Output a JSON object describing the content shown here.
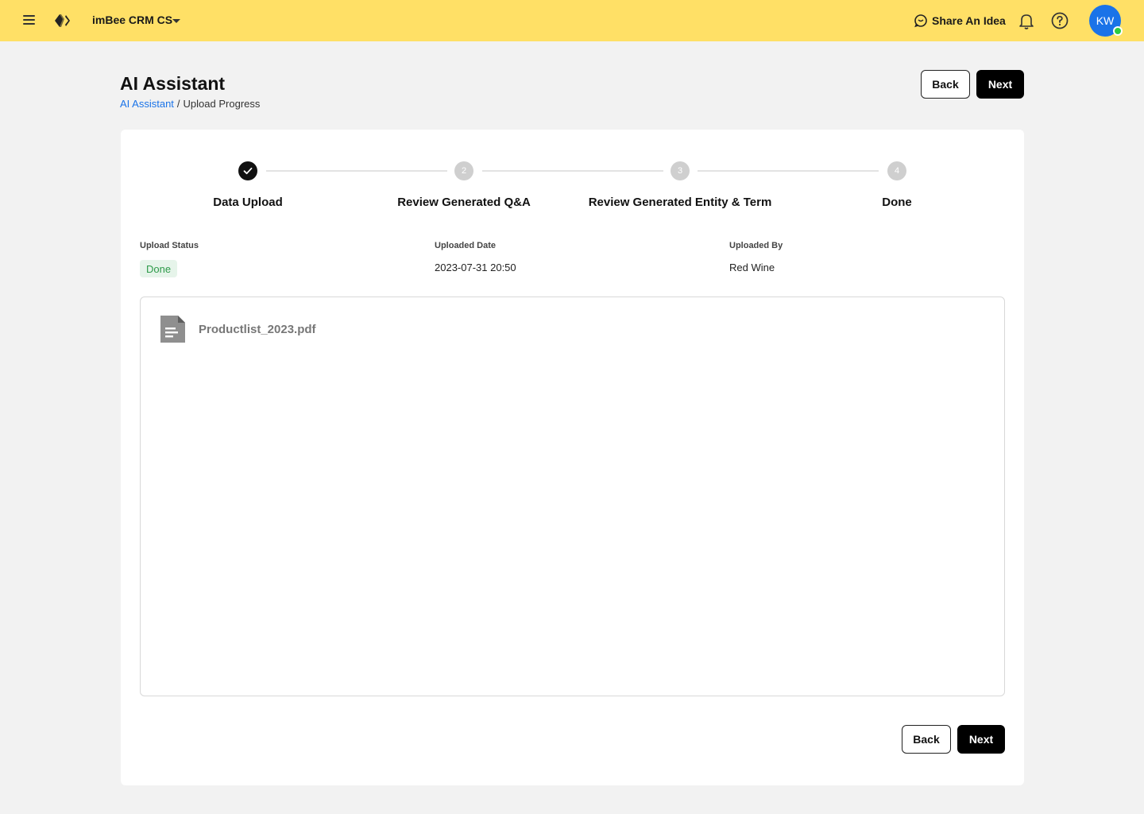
{
  "topbar": {
    "brand": "imBee CRM CS",
    "share_label": "Share An Idea",
    "avatar_initials": "KW",
    "accent_color": "#ffe066",
    "avatar_color": "#1a73e8",
    "icons": [
      "menu-icon",
      "logo-icon",
      "chevron-down-icon",
      "chat-bubble-icon",
      "bell-icon",
      "help-icon"
    ]
  },
  "header": {
    "title": "AI Assistant",
    "breadcrumb": {
      "link": "AI Assistant",
      "separator": "/",
      "current": "Upload Progress"
    },
    "back_label": "Back",
    "next_label": "Next"
  },
  "stepper": {
    "steps": [
      {
        "number": "1",
        "label": "Data Upload",
        "state": "completed"
      },
      {
        "number": "2",
        "label": "Review Generated Q&A",
        "state": "pending"
      },
      {
        "number": "3",
        "label": "Review Generated Entity & Term",
        "state": "pending"
      },
      {
        "number": "4",
        "label": "Done",
        "state": "pending"
      }
    ]
  },
  "upload_info": {
    "status_label": "Upload Status",
    "status_value": "Done",
    "date_label": "Uploaded Date",
    "date_value": "2023-07-31 20:50",
    "by_label": "Uploaded By",
    "by_value": "Red Wine"
  },
  "file": {
    "name": "Productlist_2023.pdf",
    "icon": "document-icon"
  },
  "footer": {
    "back_label": "Back",
    "next_label": "Next"
  }
}
